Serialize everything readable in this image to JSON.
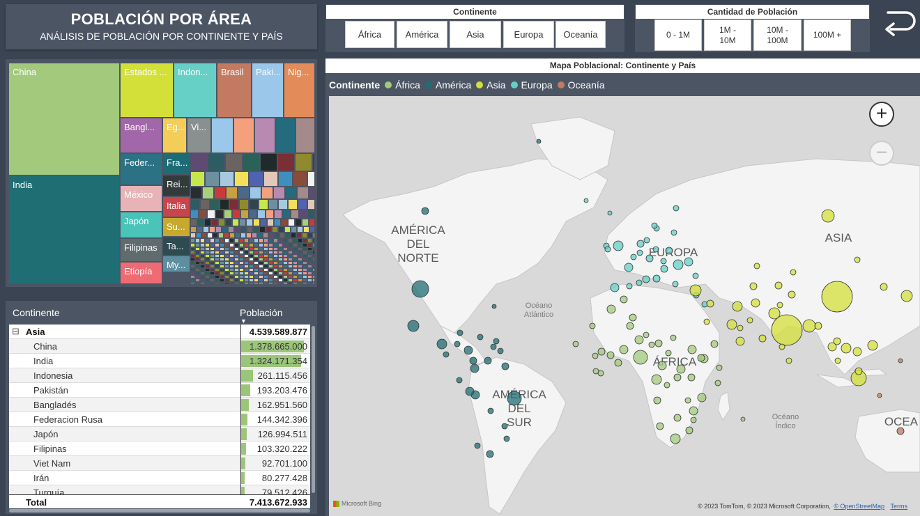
{
  "header": {
    "title": "POBLACIÓN POR ÁREA",
    "subtitle": "ANÁLISIS DE POBLACIÓN POR CONTINENTE Y PAÍS"
  },
  "colors": {
    "background": "#3b4452",
    "panel": "#4c5564",
    "africa": "#a3c97c",
    "america": "#1f6e74",
    "asia": "#d4e03a",
    "europa": "#66cfc6",
    "oceania": "#c27a61"
  },
  "continent_slicer": {
    "title": "Continente",
    "options": [
      "África",
      "América",
      "Asia",
      "Europa",
      "Oceanía"
    ]
  },
  "population_slicer": {
    "title": "Cantidad de Población",
    "options": [
      "0 - 1M",
      "1M -\n10M",
      "10M -\n100M",
      "100M +"
    ]
  },
  "back_button": {
    "icon": "undo-arrow-icon"
  },
  "treemap": {
    "cells": [
      {
        "label": "China",
        "color": "#a3c97c"
      },
      {
        "label": "India",
        "color": "#1f6e74"
      },
      {
        "label": "Estados ...",
        "color": "#d4e03a"
      },
      {
        "label": "Indon...",
        "color": "#66cfc6"
      },
      {
        "label": "Brasil",
        "color": "#c27a61"
      },
      {
        "label": "Paki...",
        "color": "#9ac7ea"
      },
      {
        "label": "Nig...",
        "color": "#e38b59"
      },
      {
        "label": "Bangl...",
        "color": "#a267a8"
      },
      {
        "label": "Eg...",
        "color": "#f3cd57"
      },
      {
        "label": "Vi...",
        "color": "#8a8f8f"
      },
      {
        "label": "Feder...",
        "color": "#2c7184"
      },
      {
        "label": "México",
        "color": "#e8b3b7"
      },
      {
        "label": "Japón",
        "color": "#4ac4b8"
      },
      {
        "label": "Filipinas",
        "color": "#5f6b6d"
      },
      {
        "label": "Etiopía",
        "color": "#ef6b74"
      },
      {
        "label": "Fra...",
        "color": "#1d6b74"
      },
      {
        "label": "Rei...",
        "color": "#333a3a"
      },
      {
        "label": "Italia",
        "color": "#c9444b"
      },
      {
        "label": "Su...",
        "color": "#c7a92f"
      },
      {
        "label": "Ta...",
        "color": "#2f4b52"
      },
      {
        "label": "My...",
        "color": "#5e8fa0"
      }
    ]
  },
  "table": {
    "col_continent": "Continente",
    "col_population": "Población",
    "group": {
      "name": "Asia",
      "value": "4.539.589.877",
      "toggle": "⊟"
    },
    "rows": [
      {
        "name": "China",
        "value": "1.378.665.000",
        "share": 1.0
      },
      {
        "name": "India",
        "value": "1.324.171.354",
        "share": 0.96
      },
      {
        "name": "Indonesia",
        "value": "261.115.456",
        "share": 0.19
      },
      {
        "name": "Pakistán",
        "value": "193.203.476",
        "share": 0.14
      },
      {
        "name": "Bangladés",
        "value": "162.951.560",
        "share": 0.118
      },
      {
        "name": "Federacion Rusa",
        "value": "144.342.396",
        "share": 0.105
      },
      {
        "name": "Japón",
        "value": "126.994.511",
        "share": 0.092
      },
      {
        "name": "Filipinas",
        "value": "103.320.222",
        "share": 0.075
      },
      {
        "name": "Viet Nam",
        "value": "92.701.100",
        "share": 0.067
      },
      {
        "name": "Irán",
        "value": "80.277.428",
        "share": 0.058
      },
      {
        "name": "Turquía",
        "value": "79.512.426",
        "share": 0.058
      }
    ],
    "total_label": "Total",
    "total_value": "7.413.672.933"
  },
  "map": {
    "title": "Mapa Poblacional: Continente y País",
    "legend_title": "Continente",
    "legend": [
      {
        "name": "África",
        "color": "#a3c97c"
      },
      {
        "name": "América",
        "color": "#1f6e74"
      },
      {
        "name": "Asia",
        "color": "#d4e03a"
      },
      {
        "name": "Europa",
        "color": "#66cfc6"
      },
      {
        "name": "Oceanía",
        "color": "#c27a61"
      }
    ],
    "labels": {
      "north_america_1": "AMÉRICA",
      "north_america_2": "DEL",
      "north_america_3": "NORTE",
      "europe": "EUROPA",
      "asia": "ASIA",
      "africa": "ÁFRICA",
      "south_america_1": "AMÉRICA",
      "south_america_2": "DEL",
      "south_america_3": "SUR",
      "atlantic_1": "Océano",
      "atlantic_2": "Atlántico",
      "indian_1": "Océano",
      "indian_2": "Índico",
      "oceania": "OCEA"
    },
    "zoom_in": "+",
    "zoom_out": "−",
    "logo": "Microsoft Bing",
    "attribution": "© 2023 TomTom, © 2023 Microsoft Corporation,",
    "osm_link": "© OpenStreetMap",
    "terms_link": "Terms"
  }
}
